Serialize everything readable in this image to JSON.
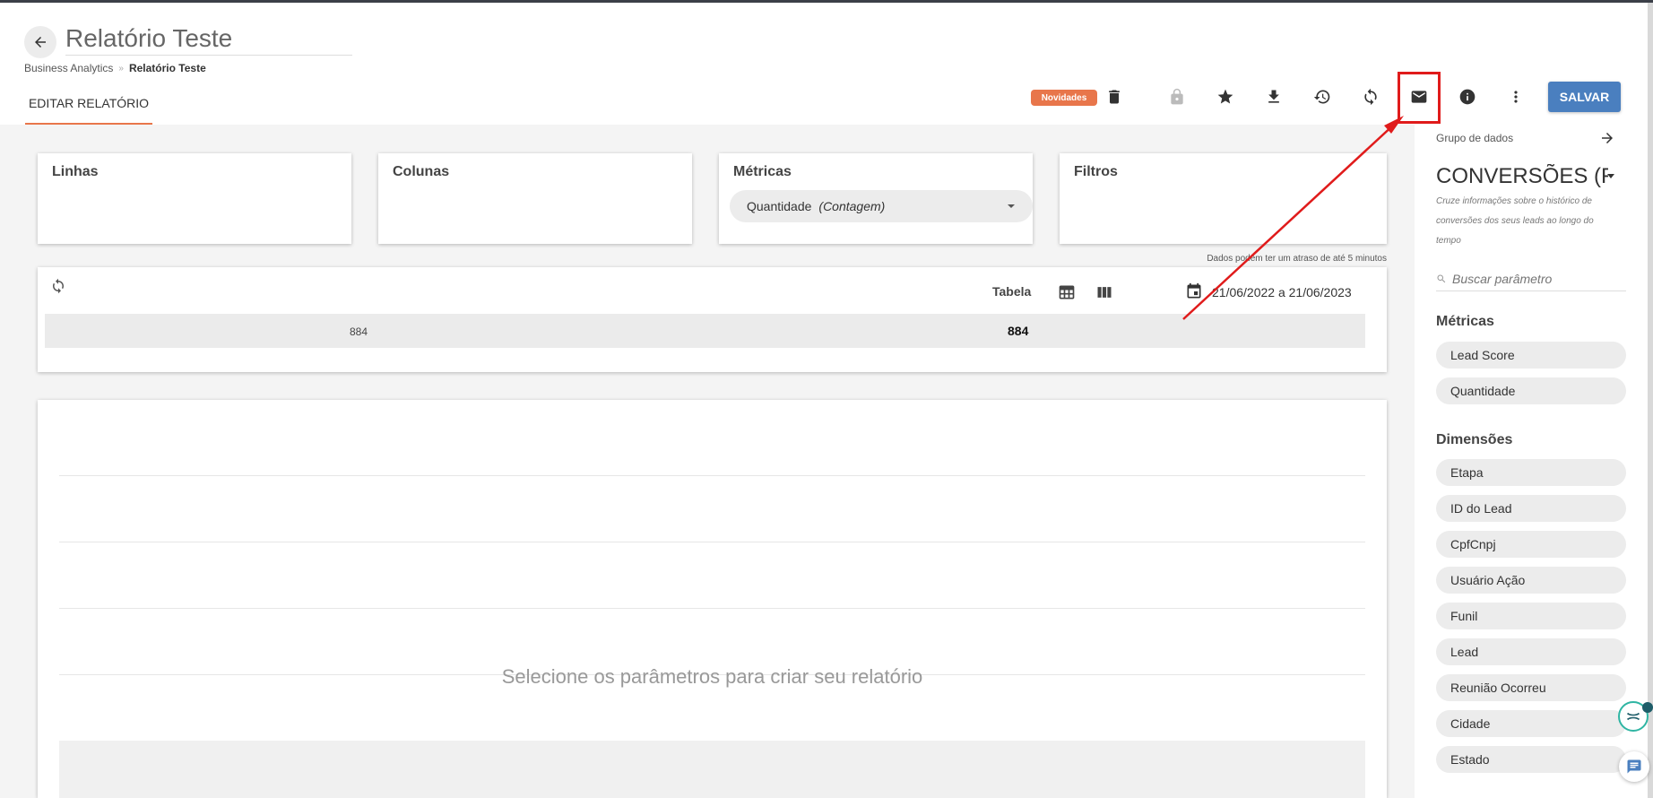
{
  "header": {
    "title": "Relatório Teste",
    "breadcrumb": {
      "root": "Business Analytics",
      "separator": "»",
      "current": "Relatório Teste"
    },
    "tab_edit": "EDITAR RELATÓRIO"
  },
  "toolbar": {
    "badge": "Novidades",
    "save_label": "SALVAR",
    "icons": [
      "delete-icon",
      "lock-icon",
      "star-icon",
      "download-icon",
      "history-icon",
      "sync-icon",
      "email-icon",
      "info-icon",
      "more-vert-icon"
    ]
  },
  "cards": {
    "rows_title": "Linhas",
    "columns_title": "Colunas",
    "metrics_title": "Métricas",
    "filters_title": "Filtros",
    "metric_chip": {
      "name": "Quantidade",
      "aggregation": "(Contagem)"
    }
  },
  "table": {
    "delay_note": "Dados podem ter um atraso de até 5 minutos",
    "view_label": "Tabela",
    "date_range": "21/06/2022 a 21/06/2023",
    "row": {
      "label_value": "884",
      "total_value": "884"
    }
  },
  "chart": {
    "empty_message": "Selecione os parâmetros para criar seu relatório"
  },
  "sidebar": {
    "group_label": "Grupo de dados",
    "group_name": "CONVERSÕES (Fu",
    "description": "Cruze informações sobre o histórico de conversões dos seus leads ao longo do tempo",
    "search_placeholder": "Buscar parâmetro",
    "metrics_title": "Métricas",
    "metrics": [
      "Lead Score",
      "Quantidade"
    ],
    "dimensions_title": "Dimensões",
    "dimensions": [
      "Etapa",
      "ID do Lead",
      "CpfCnpj",
      "Usuário Ação",
      "Funil",
      "Lead",
      "Reunião Ocorreu",
      "Cidade",
      "Estado"
    ]
  },
  "colors": {
    "accent": "#e8764b",
    "primary_button": "#4a7fbf",
    "highlight": "#e01b1b"
  }
}
